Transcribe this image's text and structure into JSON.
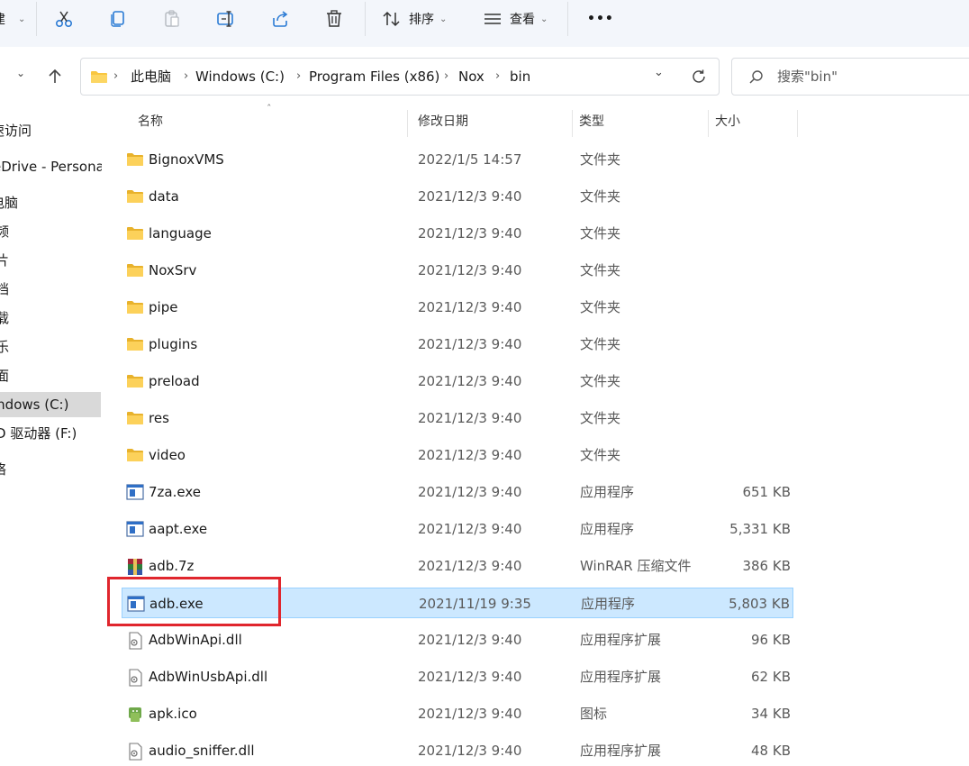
{
  "toolbar": {
    "partial_label": "建",
    "sort_label": "排序",
    "view_label": "查看",
    "more_label": "•••"
  },
  "address": {
    "crumbs": [
      "此电脑",
      "Windows (C:)",
      "Program Files (x86)",
      "Nox",
      "bin"
    ],
    "search_placeholder": "搜索\"bin\""
  },
  "nav": {
    "items": [
      "速访问",
      "eDrive - Persona",
      "电脑",
      "频",
      "片",
      "档",
      "载",
      "乐",
      "面",
      "indows (C:)",
      "D 驱动器 (F:)",
      "络"
    ],
    "selected_index": 9
  },
  "columns": {
    "name": "名称",
    "date": "修改日期",
    "type": "类型",
    "size": "大小"
  },
  "files": [
    {
      "name": "BignoxVMS",
      "date": "2022/1/5 14:57",
      "type": "文件夹",
      "size": "",
      "icon": "folder-icon"
    },
    {
      "name": "data",
      "date": "2021/12/3 9:40",
      "type": "文件夹",
      "size": "",
      "icon": "folder-icon"
    },
    {
      "name": "language",
      "date": "2021/12/3 9:40",
      "type": "文件夹",
      "size": "",
      "icon": "folder-icon"
    },
    {
      "name": "NoxSrv",
      "date": "2021/12/3 9:40",
      "type": "文件夹",
      "size": "",
      "icon": "folder-icon"
    },
    {
      "name": "pipe",
      "date": "2021/12/3 9:40",
      "type": "文件夹",
      "size": "",
      "icon": "folder-icon"
    },
    {
      "name": "plugins",
      "date": "2021/12/3 9:40",
      "type": "文件夹",
      "size": "",
      "icon": "folder-icon"
    },
    {
      "name": "preload",
      "date": "2021/12/3 9:40",
      "type": "文件夹",
      "size": "",
      "icon": "folder-icon"
    },
    {
      "name": "res",
      "date": "2021/12/3 9:40",
      "type": "文件夹",
      "size": "",
      "icon": "folder-icon"
    },
    {
      "name": "video",
      "date": "2021/12/3 9:40",
      "type": "文件夹",
      "size": "",
      "icon": "folder-icon"
    },
    {
      "name": "7za.exe",
      "date": "2021/12/3 9:40",
      "type": "应用程序",
      "size": "651 KB",
      "icon": "exe-icon"
    },
    {
      "name": "aapt.exe",
      "date": "2021/12/3 9:40",
      "type": "应用程序",
      "size": "5,331 KB",
      "icon": "exe-icon"
    },
    {
      "name": "adb.7z",
      "date": "2021/12/3 9:40",
      "type": "WinRAR 压缩文件",
      "size": "386 KB",
      "icon": "archive-icon"
    },
    {
      "name": "adb.exe",
      "date": "2021/11/19 9:35",
      "type": "应用程序",
      "size": "5,803 KB",
      "icon": "exe-icon"
    },
    {
      "name": "AdbWinApi.dll",
      "date": "2021/12/3 9:40",
      "type": "应用程序扩展",
      "size": "96 KB",
      "icon": "dll-icon"
    },
    {
      "name": "AdbWinUsbApi.dll",
      "date": "2021/12/3 9:40",
      "type": "应用程序扩展",
      "size": "62 KB",
      "icon": "dll-icon"
    },
    {
      "name": "apk.ico",
      "date": "2021/12/3 9:40",
      "type": "图标",
      "size": "34 KB",
      "icon": "android-icon"
    },
    {
      "name": "audio_sniffer.dll",
      "date": "2021/12/3 9:40",
      "type": "应用程序扩展",
      "size": "48 KB",
      "icon": "dll-icon"
    }
  ],
  "selected_file_index": 12,
  "colors": {
    "selection_bg": "#cce8ff",
    "selection_border": "#99d1ff",
    "highlight_box": "#e0262d",
    "folder": "#f8c640"
  }
}
